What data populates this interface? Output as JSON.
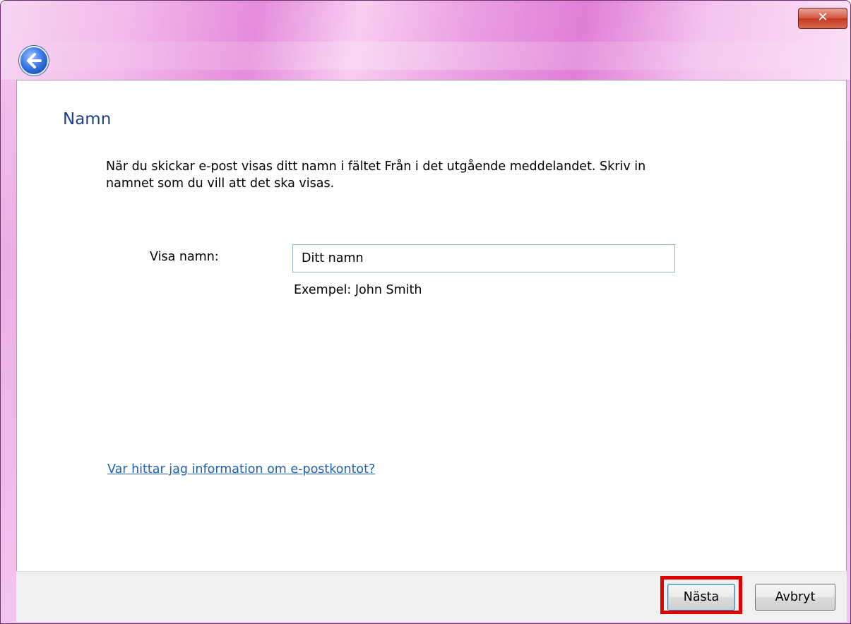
{
  "window": {
    "close_label": "✕"
  },
  "page": {
    "title": "Namn",
    "description": "När du skickar e-post visas ditt namn i fältet Från i det utgående meddelandet. Skriv in namnet som du vill att det ska visas."
  },
  "form": {
    "display_name_label": "Visa namn:",
    "display_name_value": "Ditt namn",
    "example_text": "Exempel: John Smith"
  },
  "help": {
    "link_text": "Var hittar jag information om e-postkontot?"
  },
  "footer": {
    "next_label": "Nästa",
    "cancel_label": "Avbryt"
  },
  "colors": {
    "title_text": "#1e3f8a",
    "link": "#1d5fb0",
    "highlight": "#e00000"
  }
}
